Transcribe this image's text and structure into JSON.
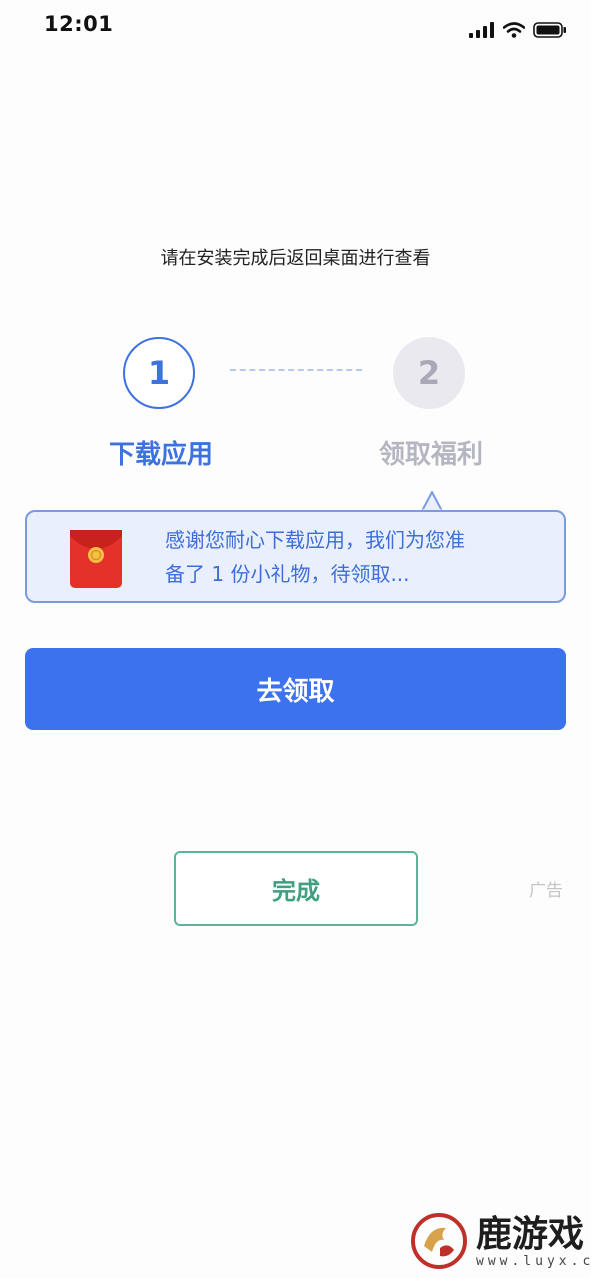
{
  "status_bar": {
    "time": "12:01"
  },
  "instruction": "请在安装完成后返回桌面进行查看",
  "steps": [
    {
      "number": "1",
      "label": "下载应用",
      "state": "active"
    },
    {
      "number": "2",
      "label": "领取福利",
      "state": "inactive"
    }
  ],
  "tip": {
    "line1": "感谢您耐心下载应用，我们为您准",
    "line2": "备了 1 份小礼物，待领取..."
  },
  "claim_button": "去领取",
  "done_button": "完成",
  "ad_label": "广告",
  "watermark": {
    "name": "鹿游戏",
    "url": "www.luyx.cn"
  },
  "colors": {
    "accent": "#3d72ee",
    "done_border": "#5cb39a",
    "tip_bg": "#e9effc",
    "redpacket": "#e4322b"
  },
  "icons": [
    "signal-icon",
    "wifi-icon",
    "battery-icon",
    "red-packet-icon",
    "deer-logo-icon"
  ]
}
